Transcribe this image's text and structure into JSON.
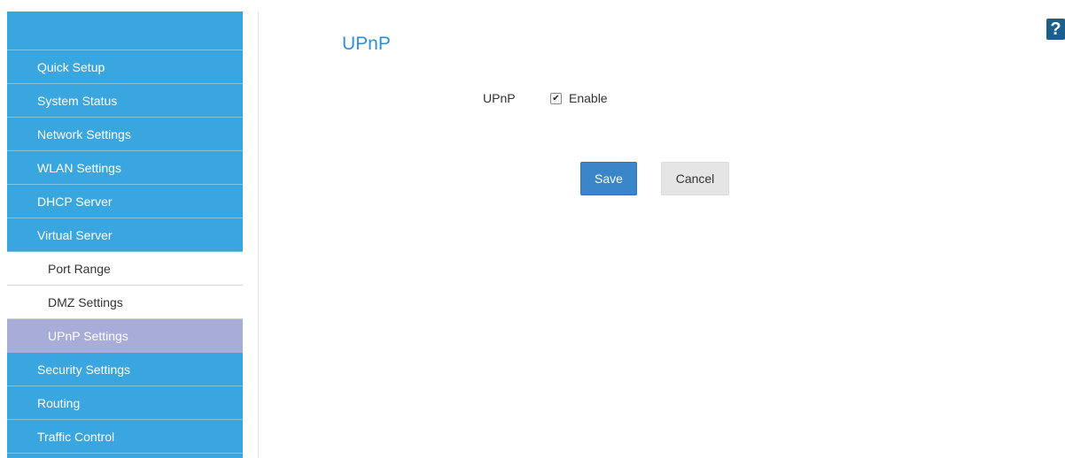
{
  "sidebar": {
    "items": [
      {
        "label": "Quick Setup"
      },
      {
        "label": "System Status"
      },
      {
        "label": "Network Settings"
      },
      {
        "label": "WLAN Settings"
      },
      {
        "label": "DHCP Server"
      },
      {
        "label": "Virtual Server"
      },
      {
        "label": "Port Range"
      },
      {
        "label": "DMZ Settings"
      },
      {
        "label": "UPnP Settings"
      },
      {
        "label": "Security Settings"
      },
      {
        "label": "Routing"
      },
      {
        "label": "Traffic Control"
      }
    ]
  },
  "main": {
    "title": "UPnP",
    "upnp_label": "UPnP",
    "enable_label": "Enable",
    "enable_checked": true,
    "save_label": "Save",
    "cancel_label": "Cancel"
  },
  "help": {
    "icon": "help-icon",
    "glyph": "?"
  },
  "colors": {
    "sidebar": "#3aa6df",
    "active": "#a8acd9",
    "title": "#2f8fd3",
    "save": "#3a86c8"
  }
}
